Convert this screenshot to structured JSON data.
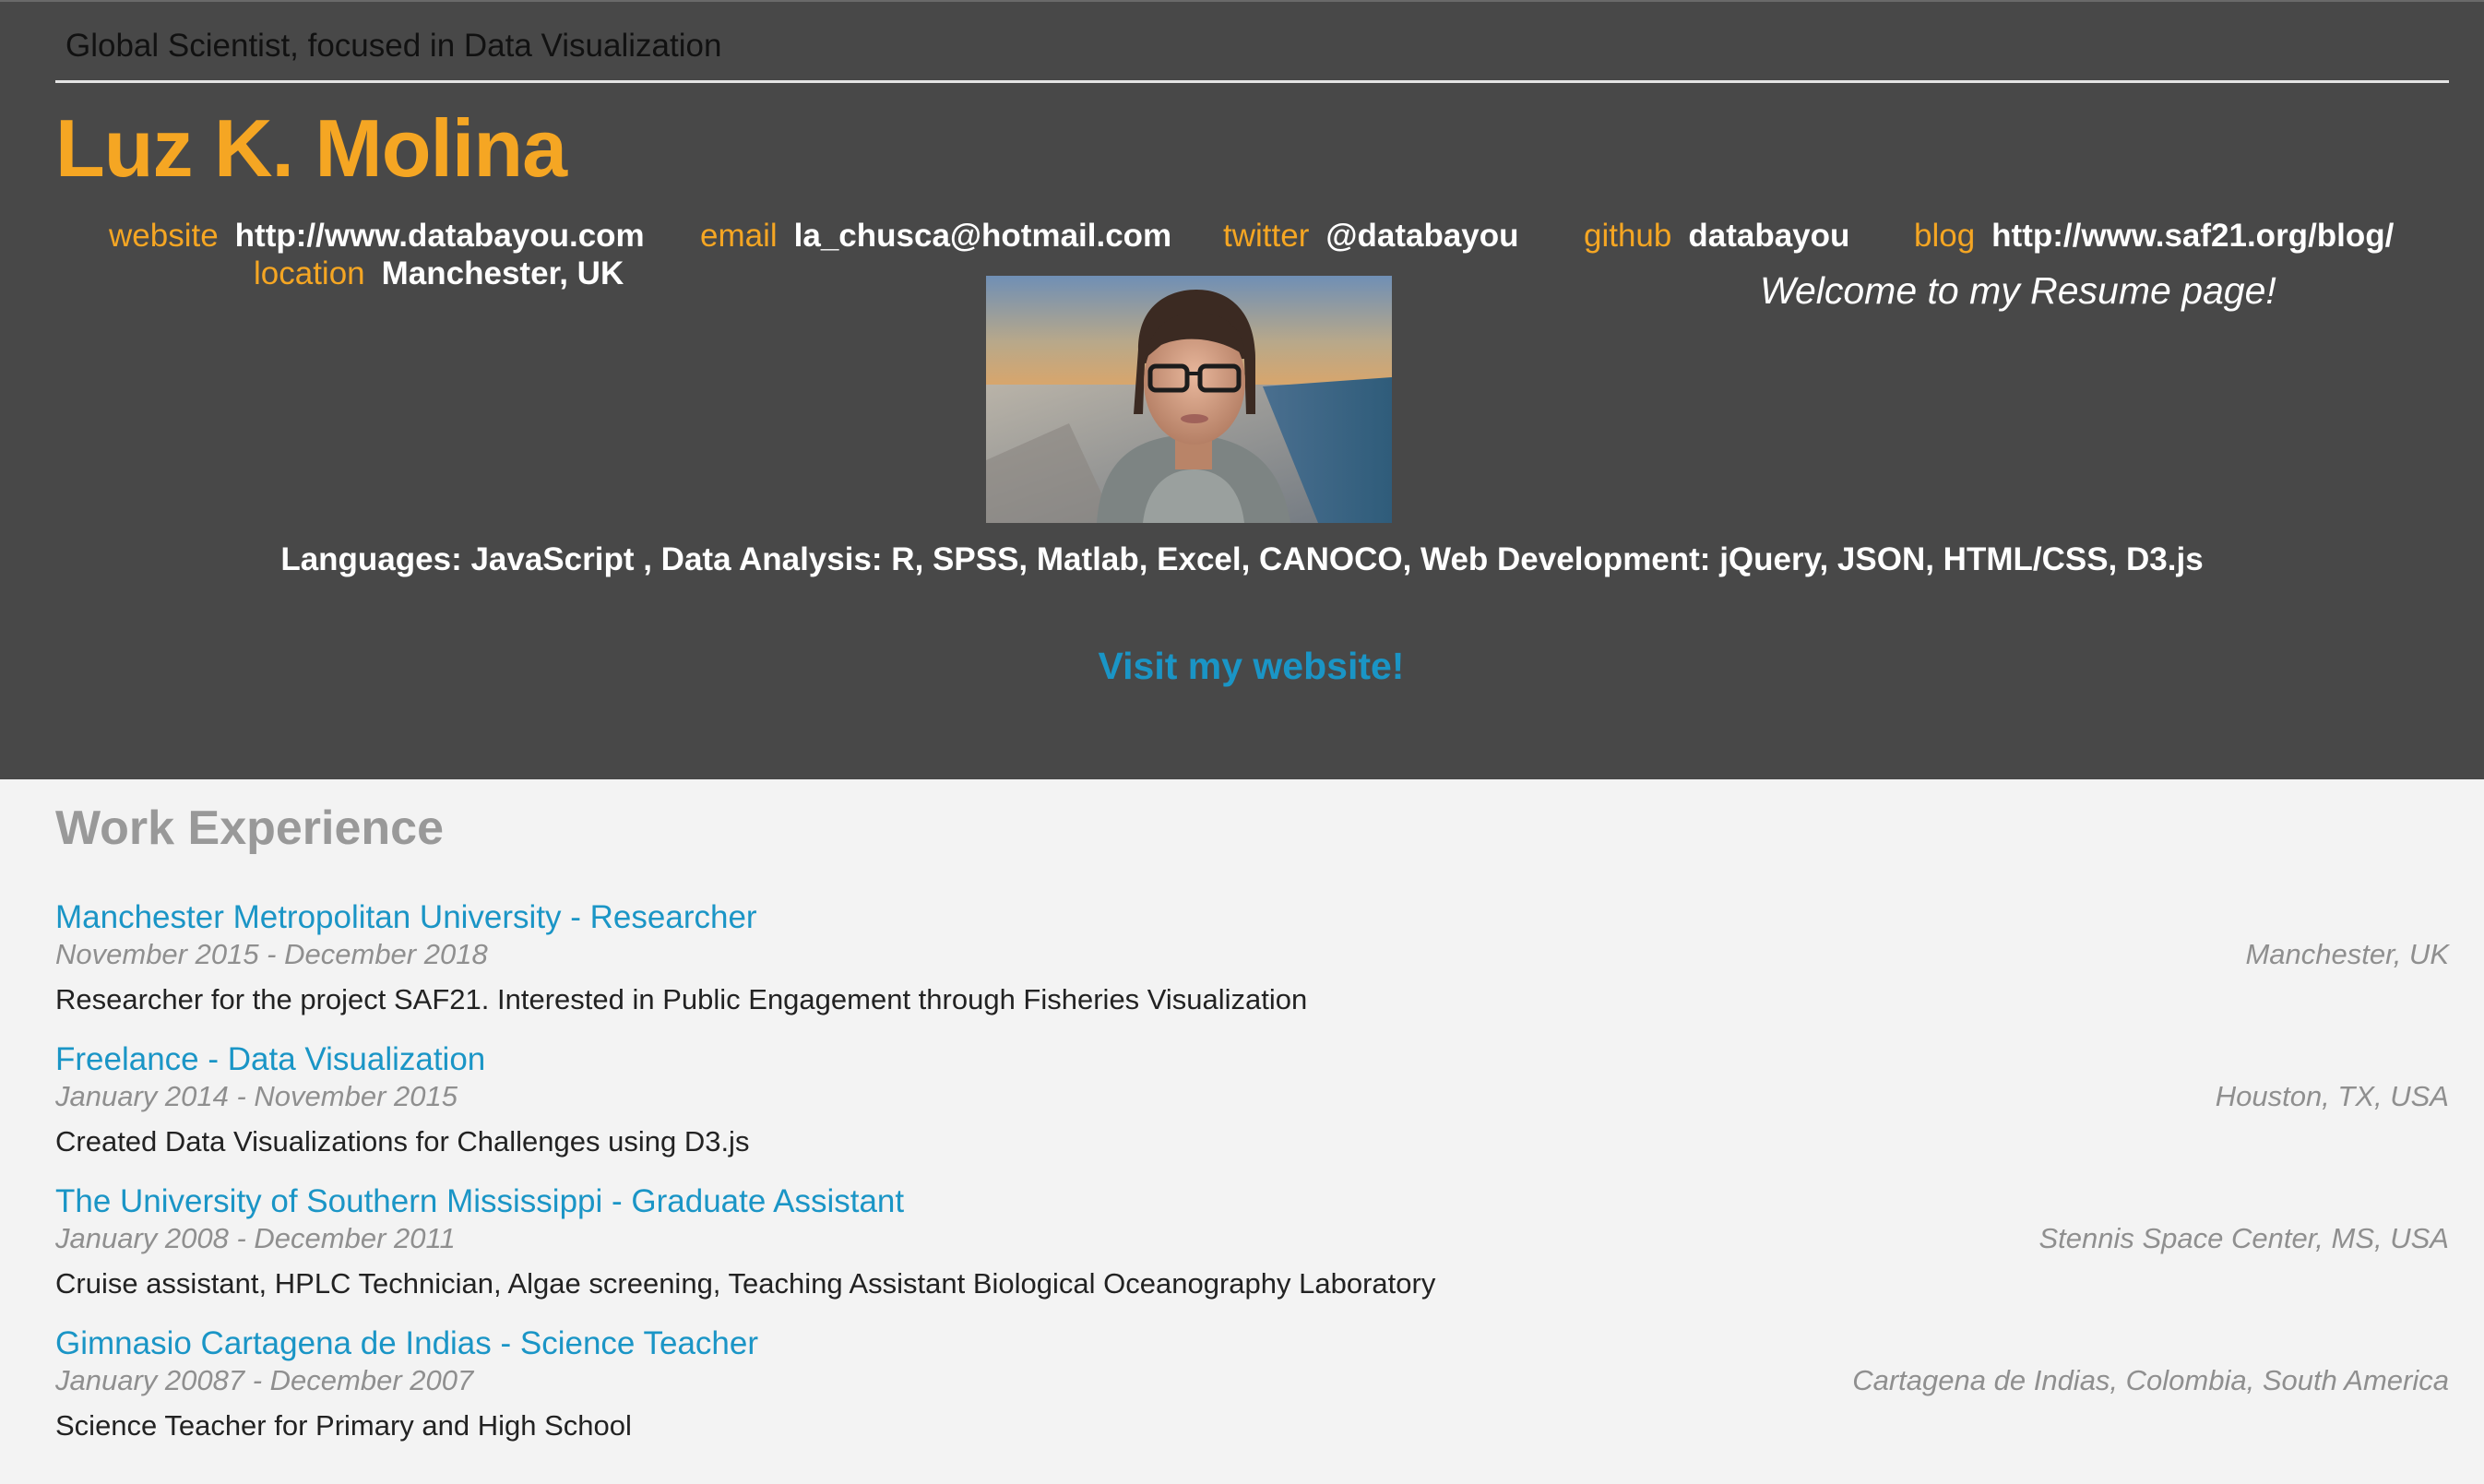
{
  "header": {
    "tagline": "Global Scientist, focused in Data Visualization",
    "name": "Luz K. Molina",
    "contacts": {
      "website": {
        "label": "website",
        "value": "http://www.databayou.com"
      },
      "email": {
        "label": "email",
        "value": "la_chusca@hotmail.com"
      },
      "twitter": {
        "label": "twitter",
        "value": "@databayou"
      },
      "github": {
        "label": "github",
        "value": "databayou"
      },
      "blog": {
        "label": "blog",
        "value": "http://www.saf21.org/blog/"
      },
      "location": {
        "label": "location",
        "value": "Manchester, UK"
      }
    },
    "welcome": "Welcome to my Resume page!",
    "languages": "Languages: JavaScript , Data Analysis: R, SPSS, Matlab, Excel, CANOCO, Web Development: jQuery, JSON, HTML/CSS, D3.js",
    "visit_link": "Visit my website!"
  },
  "work": {
    "title": "Work Experience",
    "jobs": [
      {
        "title": "Manchester Metropolitan University - Researcher",
        "dates": "November 2015 - December 2018",
        "location": "Manchester, UK",
        "description": "Researcher for the project SAF21. Interested in Public Engagement through Fisheries Visualization"
      },
      {
        "title": "Freelance - Data Visualization",
        "dates": "January 2014 - November 2015",
        "location": "Houston, TX, USA",
        "description": "Created Data Visualizations for Challenges using D3.js"
      },
      {
        "title": "The University of Southern Mississippi - Graduate Assistant",
        "dates": "January 2008 - December 2011",
        "location": "Stennis Space Center, MS, USA",
        "description": "Cruise assistant, HPLC Technician, Algae screening, Teaching Assistant Biological Oceanography Laboratory"
      },
      {
        "title": "Gimnasio Cartagena de Indias - Science Teacher",
        "dates": "January 20087 - December 2007",
        "location": "Cartagena de Indias, Colombia, South America",
        "description": "Science Teacher for Primary and High School"
      }
    ]
  },
  "colors": {
    "header_bg": "#484848",
    "accent_orange": "#f5a623",
    "link_blue": "#1a95c6",
    "page_bg": "#f3f3f3"
  }
}
